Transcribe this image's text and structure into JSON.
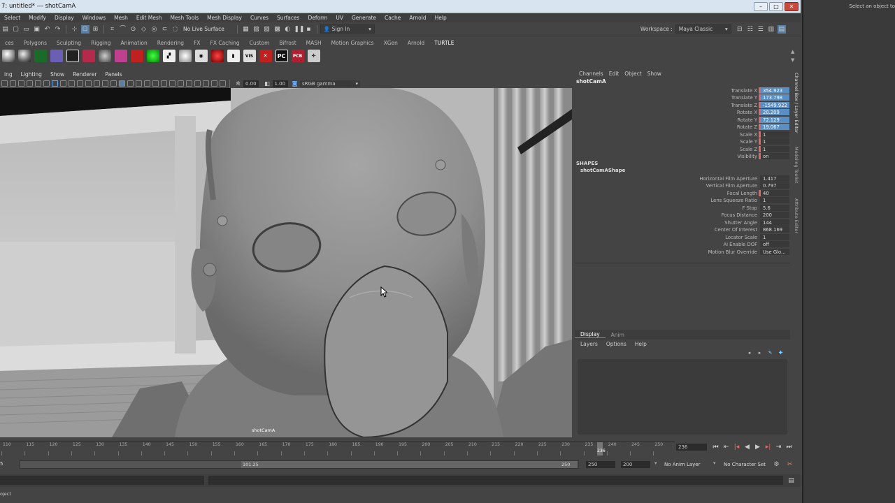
{
  "window": {
    "title": "7: untitled*   ---   shotCamA"
  },
  "menubar": [
    "Select",
    "Modify",
    "Display",
    "Windows",
    "Mesh",
    "Edit Mesh",
    "Mesh Tools",
    "Mesh Display",
    "Curves",
    "Surfaces",
    "Deform",
    "UV",
    "Generate",
    "Cache",
    "Arnold",
    "Help"
  ],
  "workspace": {
    "label": "Workspace :",
    "value": "Maya Classic"
  },
  "statusline": {
    "live_surface": "No Live Surface",
    "sign_in": "Sign In"
  },
  "shelf_tabs": [
    "ces",
    "Polygons",
    "Sculpting",
    "Rigging",
    "Animation",
    "Rendering",
    "FX",
    "FX Caching",
    "Custom",
    "Bifrost",
    "MASH",
    "Motion Graphics",
    "XGen",
    "Arnold",
    "TURTLE"
  ],
  "shelf_active": "TURTLE",
  "shelf_icons": [
    "VIS",
    "PC",
    "PCB"
  ],
  "viewport": {
    "menu": [
      "ing",
      "Lighting",
      "Show",
      "Renderer",
      "Panels"
    ],
    "field1": "0.00",
    "field2": "1.00",
    "colorspace": "sRGB gamma",
    "camera_label": "shotCamA"
  },
  "channel_box": {
    "menu": [
      "Channels",
      "Edit",
      "Object",
      "Show"
    ],
    "object": "shotCamA",
    "channels": [
      {
        "label": "Translate X",
        "value": "354.923"
      },
      {
        "label": "Translate Y",
        "value": "173.798"
      },
      {
        "label": "Translate Z",
        "value": "-1549.922"
      },
      {
        "label": "Rotate X",
        "value": "20.209"
      },
      {
        "label": "Rotate Y",
        "value": "72.129"
      },
      {
        "label": "Rotate Z",
        "value": "19.067"
      },
      {
        "label": "Scale X",
        "value": "1"
      },
      {
        "label": "Scale Y",
        "value": "1"
      },
      {
        "label": "Scale Z",
        "value": "1"
      },
      {
        "label": "Visibility",
        "value": "on"
      }
    ],
    "shapes_header": "SHAPES",
    "shape_name": "shotCamAShape",
    "shape_attrs": [
      {
        "label": "Horizontal Film Aperture",
        "value": "1.417"
      },
      {
        "label": "Vertical Film Aperture",
        "value": "0.797"
      },
      {
        "label": "Focal Length",
        "value": "40"
      },
      {
        "label": "Lens Squeeze Ratio",
        "value": "1"
      },
      {
        "label": "F Stop",
        "value": "5.6"
      },
      {
        "label": "Focus Distance",
        "value": "200"
      },
      {
        "label": "Shutter Angle",
        "value": "144"
      },
      {
        "label": "Center Of Interest",
        "value": "868.169"
      },
      {
        "label": "Locator Scale",
        "value": "1"
      },
      {
        "label": "Ai Enable DOF",
        "value": "off"
      },
      {
        "label": "Motion Blur Override",
        "value": "Use Glo..."
      }
    ]
  },
  "side_tabs": [
    "Channel Box / Layer Editor",
    "Modeling Toolkit",
    "Attribute Editor"
  ],
  "layer_editor": {
    "tabs": [
      "Display",
      "Anim"
    ],
    "menu": [
      "Layers",
      "Options",
      "Help"
    ]
  },
  "timeline": {
    "ticks": [
      "110",
      "115",
      "120",
      "125",
      "130",
      "135",
      "140",
      "145",
      "150",
      "155",
      "160",
      "165",
      "170",
      "175",
      "180",
      "185",
      "190",
      "195",
      "200",
      "205",
      "210",
      "215",
      "220",
      "225",
      "230",
      "235",
      "240",
      "245",
      "250"
    ],
    "current_frame": "236",
    "current_marker": "236"
  },
  "range": {
    "start": "5",
    "slider_value": "101.25",
    "slider_end": "250",
    "end": "250",
    "end2": "200",
    "anim_layer": "No Anim Layer",
    "char_set": "No Character Set"
  },
  "help_line": "oject",
  "right_panel": {
    "hint": "Select an object to"
  },
  "colors": {
    "key_blue": "#5a8fc4",
    "key_red": "#d66666",
    "title_bg": "#d9e4f1"
  }
}
